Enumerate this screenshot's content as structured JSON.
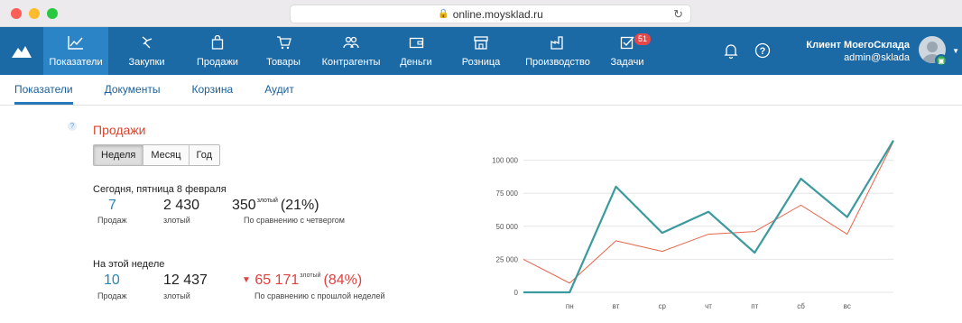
{
  "browser": {
    "url": "online.moysklad.ru"
  },
  "nav": {
    "items": [
      {
        "label": "Показатели",
        "icon": "line-chart-icon"
      },
      {
        "label": "Закупки",
        "icon": "purchases-icon"
      },
      {
        "label": "Продажи",
        "icon": "shopping-bag-icon"
      },
      {
        "label": "Товары",
        "icon": "cart-icon"
      },
      {
        "label": "Контрагенты",
        "icon": "people-icon"
      },
      {
        "label": "Деньги",
        "icon": "wallet-icon"
      },
      {
        "label": "Розница",
        "icon": "store-icon"
      },
      {
        "label": "Производство",
        "icon": "factory-icon"
      },
      {
        "label": "Задачи",
        "icon": "checkbox-icon"
      }
    ],
    "tasks_badge": "51",
    "user_name": "Клиент МоегоСклада",
    "user_login": "admin@sklada"
  },
  "subnav": {
    "tabs": [
      "Показатели",
      "Документы",
      "Корзина",
      "Аудит"
    ]
  },
  "sales": {
    "title": "Продажи",
    "periods": [
      "Неделя",
      "Месяц",
      "Год"
    ],
    "selected_period": "Неделя",
    "today": {
      "label": "Сегодня, пятница 8 февраля",
      "count": "7",
      "count_label": "Продаж",
      "amount": "2 430",
      "amount_label": "злотый",
      "diff": "350",
      "diff_unit": "злотый",
      "diff_pct": "(21%)",
      "diff_label": "По сравнению с четвергом"
    },
    "week": {
      "label": "На этой неделе",
      "count": "10",
      "count_label": "Продаж",
      "amount": "12 437",
      "amount_label": "злотый",
      "diff": "65 171",
      "diff_unit": "злотый",
      "diff_pct": "(84%)",
      "diff_label": "По сравнению с прошлой неделей"
    }
  },
  "colors": {
    "nav_bg": "#1b6aa6",
    "nav_active": "#2b84c6",
    "series_current": "#3a9a9e",
    "series_previous": "#e8654a",
    "accent_red": "#d9442c"
  },
  "chart_data": {
    "type": "line",
    "x": [
      "",
      "пн",
      "вт",
      "ср",
      "чт",
      "пт",
      "сб",
      "вс"
    ],
    "yticks": [
      "0",
      "25 000",
      "50 000",
      "75 000",
      "100 000"
    ],
    "ylim": [
      0,
      125000
    ],
    "grid": true,
    "series": [
      {
        "values": [
          0,
          0,
          80000,
          45000,
          61000,
          30000,
          86000,
          57000,
          115000
        ]
      },
      {
        "values": [
          25000,
          7000,
          39000,
          31000,
          44000,
          46000,
          66000,
          44000,
          114000
        ]
      }
    ]
  }
}
